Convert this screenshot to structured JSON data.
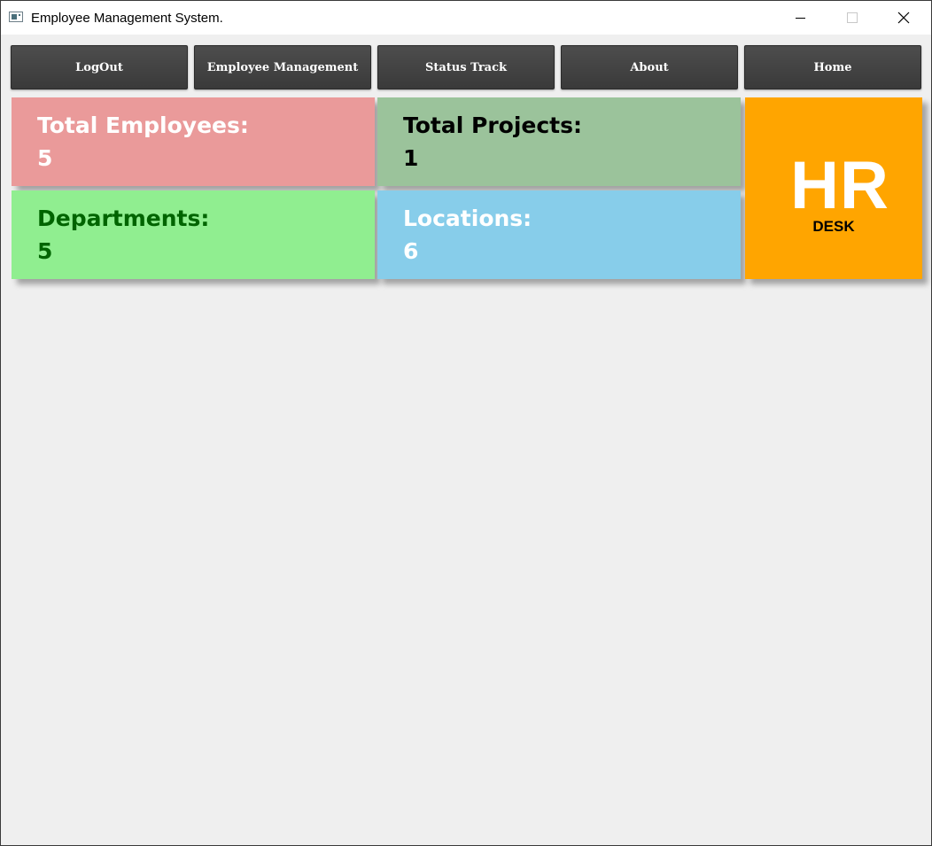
{
  "window": {
    "title": "Employee Management System."
  },
  "navbar": {
    "buttons": [
      {
        "label": "LogOut"
      },
      {
        "label": "Employee Management"
      },
      {
        "label": "Status Track"
      },
      {
        "label": "About"
      },
      {
        "label": "Home"
      }
    ]
  },
  "dashboard": {
    "total_employees": {
      "label": "Total Employees:",
      "value": "5",
      "color": "#ea9a9a"
    },
    "total_projects": {
      "label": "Total Projects:",
      "value": "1",
      "color": "#9bc39b"
    },
    "departments": {
      "label": "Departments:",
      "value": "5",
      "color": "#90ee90"
    },
    "locations": {
      "label": "Locations:",
      "value": "6",
      "color": "#87cdea"
    }
  },
  "logo": {
    "main": "HR",
    "sub": "DESK",
    "color": "#ffa500"
  }
}
